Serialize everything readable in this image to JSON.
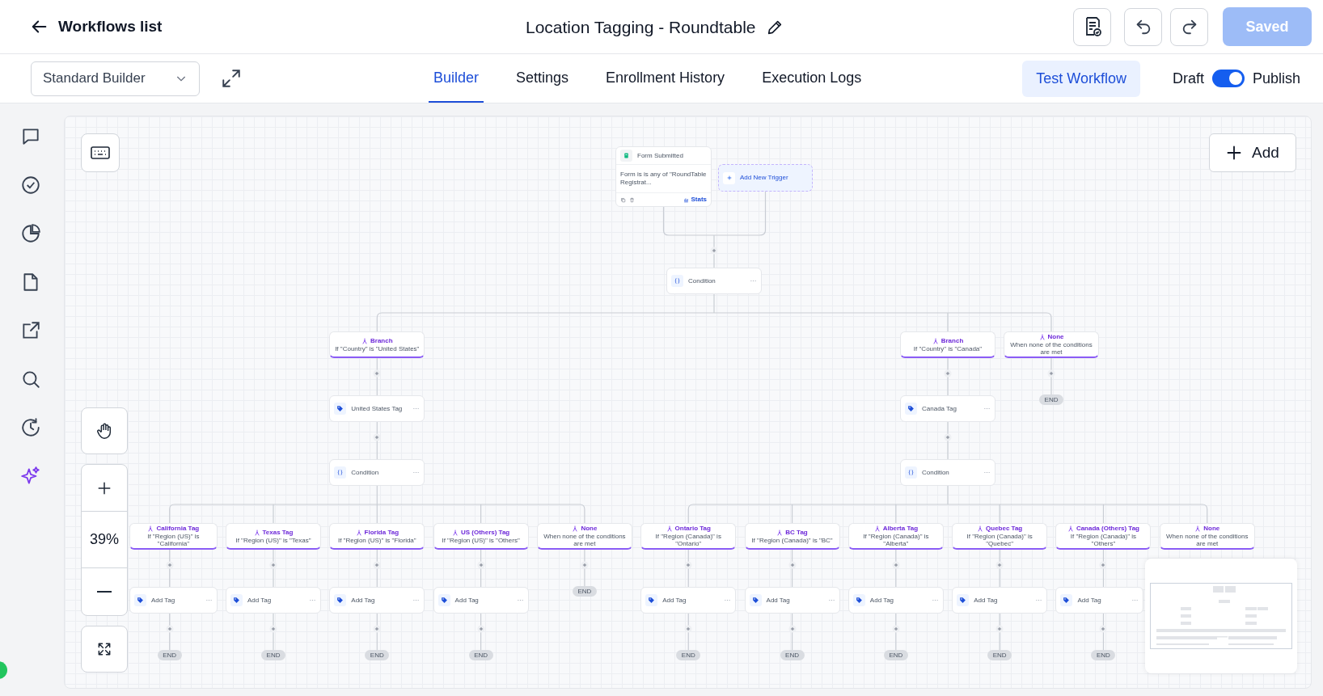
{
  "header": {
    "back_label": "Workflows list",
    "title": "Location Tagging - Roundtable",
    "save_button": "Saved"
  },
  "toolbar": {
    "builder_select": "Standard Builder",
    "tabs": [
      {
        "label": "Builder",
        "selected": true
      },
      {
        "label": "Settings",
        "selected": false
      },
      {
        "label": "Enrollment History",
        "selected": false
      },
      {
        "label": "Execution Logs",
        "selected": false
      }
    ],
    "test_button": "Test Workflow",
    "draft_label": "Draft",
    "publish": {
      "label": "Publish",
      "on": true
    }
  },
  "canvas": {
    "add_button": "Add",
    "zoom_level": "39%",
    "trigger": {
      "title": "Form Submitted",
      "detail": "Form is is any of \"RoundTable Registrat...",
      "stats": "Stats"
    },
    "add_trigger": "Add New Trigger",
    "flow": {
      "kind": "condition",
      "label": "Condition",
      "branches": [
        {
          "title": "Branch",
          "condition": "If \"Country\" is \"United States\"",
          "steps": [
            {
              "kind": "action",
              "label": "United States Tag"
            },
            {
              "kind": "condition",
              "label": "Condition",
              "branches": [
                {
                  "title": "California Tag",
                  "condition": "If \"Region (US)\" is \"California\"",
                  "steps": [
                    {
                      "kind": "action",
                      "label": "Add Tag"
                    },
                    {
                      "kind": "end",
                      "label": "END"
                    }
                  ]
                },
                {
                  "title": "Texas Tag",
                  "condition": "If \"Region (US)\" is \"Texas\"",
                  "steps": [
                    {
                      "kind": "action",
                      "label": "Add Tag"
                    },
                    {
                      "kind": "end",
                      "label": "END"
                    }
                  ]
                },
                {
                  "title": "Florida Tag",
                  "condition": "If \"Region (US)\" is \"Florida\"",
                  "steps": [
                    {
                      "kind": "action",
                      "label": "Add Tag"
                    },
                    {
                      "kind": "end",
                      "label": "END"
                    }
                  ]
                },
                {
                  "title": "US (Others) Tag",
                  "condition": "If \"Region (US)\" is \"Others\"",
                  "steps": [
                    {
                      "kind": "action",
                      "label": "Add Tag"
                    },
                    {
                      "kind": "end",
                      "label": "END"
                    }
                  ]
                },
                {
                  "title": "None",
                  "condition": "When none of the conditions are met",
                  "steps": [
                    {
                      "kind": "end",
                      "label": "END"
                    }
                  ]
                }
              ]
            }
          ]
        },
        {
          "title": "Branch",
          "condition": "If \"Country\" is \"Canada\"",
          "steps": [
            {
              "kind": "action",
              "label": "Canada Tag"
            },
            {
              "kind": "condition",
              "label": "Condition",
              "branches": [
                {
                  "title": "Ontario Tag",
                  "condition": "If \"Region (Canada)\" is \"Ontario\"",
                  "steps": [
                    {
                      "kind": "action",
                      "label": "Add Tag"
                    },
                    {
                      "kind": "end",
                      "label": "END"
                    }
                  ]
                },
                {
                  "title": "BC Tag",
                  "condition": "If \"Region (Canada)\" is \"BC\"",
                  "steps": [
                    {
                      "kind": "action",
                      "label": "Add Tag"
                    },
                    {
                      "kind": "end",
                      "label": "END"
                    }
                  ]
                },
                {
                  "title": "Alberta Tag",
                  "condition": "If \"Region (Canada)\" is \"Alberta\"",
                  "steps": [
                    {
                      "kind": "action",
                      "label": "Add Tag"
                    },
                    {
                      "kind": "end",
                      "label": "END"
                    }
                  ]
                },
                {
                  "title": "Quebec Tag",
                  "condition": "If \"Region (Canada)\" is \"Quebec\"",
                  "steps": [
                    {
                      "kind": "action",
                      "label": "Add Tag"
                    },
                    {
                      "kind": "end",
                      "label": "END"
                    }
                  ]
                },
                {
                  "title": "Canada (Others) Tag",
                  "condition": "If \"Region (Canada)\" is \"Others\"",
                  "steps": [
                    {
                      "kind": "action",
                      "label": "Add Tag"
                    },
                    {
                      "kind": "end",
                      "label": "END"
                    }
                  ]
                },
                {
                  "title": "None",
                  "condition": "When none of the conditions are met"
                }
              ]
            }
          ]
        },
        {
          "title": "None",
          "condition": "When none of the conditions are met",
          "steps": [
            {
              "kind": "end",
              "label": "END"
            }
          ]
        }
      ]
    }
  }
}
